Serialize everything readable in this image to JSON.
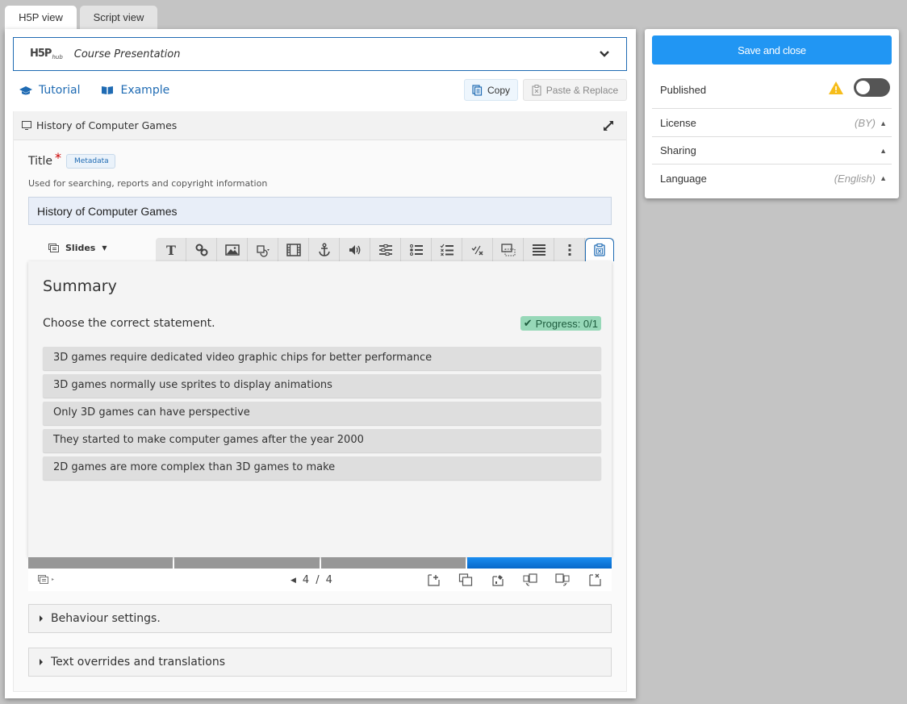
{
  "tabs": [
    {
      "label": "H5P view",
      "active": true
    },
    {
      "label": "Script view",
      "active": false
    }
  ],
  "hub": {
    "logo_text": "H5P",
    "logo_sub": "hub",
    "content_type": "Course Presentation"
  },
  "links": {
    "tutorial": "Tutorial",
    "example": "Example"
  },
  "actions": {
    "copy": "Copy",
    "paste_replace": "Paste & Replace"
  },
  "content": {
    "header_title": "History of Computer Games",
    "title_label": "Title",
    "required_mark": "*",
    "metadata_label": "Metadata",
    "title_description": "Used for searching, reports and copyright information",
    "title_value": "History of Computer Games",
    "slides_label": "Slides"
  },
  "toolbar": {
    "buttons": [
      "text",
      "link",
      "image",
      "shapes",
      "video",
      "anchor",
      "audio",
      "fill-in-blanks",
      "single-choice",
      "multiple-choice",
      "true-false",
      "drag-text",
      "summary-list",
      "more",
      "paste"
    ]
  },
  "slide": {
    "title": "Summary",
    "question": "Choose the correct statement.",
    "progress": "Progress: 0/1",
    "statements": [
      "3D games require dedicated video graphic chips for better performance",
      "3D games normally use sprites to display animations",
      "Only 3D games can have perspective",
      "They started to make computer games after the year 2000",
      "2D games are more complex than 3D games to make"
    ]
  },
  "navigation": {
    "current": "4",
    "separator": "/",
    "total": "4",
    "segments": 4,
    "current_segment": 4
  },
  "sections": {
    "behaviour": "Behaviour settings.",
    "text_overrides": "Text overrides and translations"
  },
  "sidebar": {
    "save_close": "Save and close",
    "published_label": "Published",
    "published": false,
    "license_label": "License",
    "license_value": "(BY)",
    "sharing_label": "Sharing",
    "language_label": "Language",
    "language_value": "(English)"
  },
  "colors": {
    "accent": "#2196f3",
    "brand_blue": "#1f6bb3",
    "progress_badge": "#97d8b8",
    "warning": "#f6bd1a"
  }
}
